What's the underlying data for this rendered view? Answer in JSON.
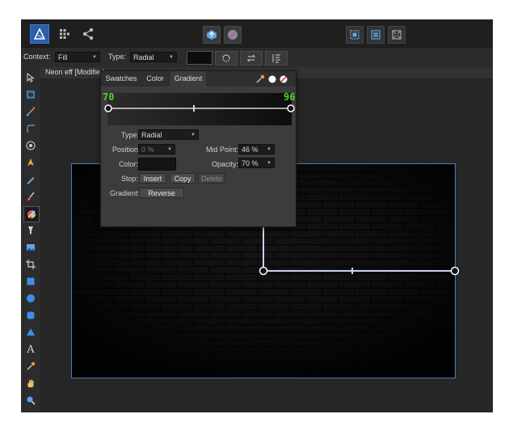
{
  "topbar": {
    "icons": [
      "affinity-logo-icon",
      "grid-persona-icon",
      "share-icon",
      "assistant-icon",
      "snapping-icon",
      "align-icon",
      "distribute-icon",
      "transform-icon"
    ]
  },
  "context_toolbar": {
    "context_label": "Context:",
    "context_value": "Fill",
    "type_label": "Type:",
    "type_value": "Radial"
  },
  "document_tab": {
    "title": "Neon eff [Modified"
  },
  "gradient_panel": {
    "tabs": [
      "Swatches",
      "Color",
      "Gradient"
    ],
    "active_tab": "Gradient",
    "stop_left": "70",
    "stop_right": "96",
    "type_label": "Type:",
    "type_value": "Radial",
    "position_label": "Position:",
    "position_value": "0 %",
    "midpoint_label": "Mid Point:",
    "midpoint_value": "46 %",
    "color_label": "Color:",
    "opacity_label": "Opacity:",
    "opacity_value": "70 %",
    "stop_label": "Stop:",
    "insert_label": "Insert",
    "copy_label": "Copy",
    "delete_label": "Delete",
    "gradient_label": "Gradient:",
    "reverse_label": "Reverse",
    "stop_values_fraction": [
      0.0,
      1.0
    ],
    "midpoint_fraction": 0.46,
    "opacity_fraction": 0.7
  },
  "colors": {
    "accent_blue": "#4a90d9",
    "stop_number_green": "#4fd12b",
    "panel_bg": "#3c3c3c",
    "app_bg": "#2a2a2a"
  },
  "tools": [
    "move-tool-icon",
    "artboard-tool-icon",
    "node-tool-icon",
    "corner-tool-icon",
    "radial-tool-icon",
    "pen-tool-icon",
    "pencil-tool-icon",
    "brush-tool-icon",
    "fill-tool-icon",
    "transparency-tool-icon",
    "place-image-tool-icon",
    "crop-tool-icon",
    "rectangle-tool-icon",
    "ellipse-tool-icon",
    "rounded-rect-tool-icon",
    "triangle-tool-icon",
    "text-tool-icon",
    "color-picker-tool-icon",
    "hand-tool-icon",
    "zoom-tool-icon"
  ]
}
